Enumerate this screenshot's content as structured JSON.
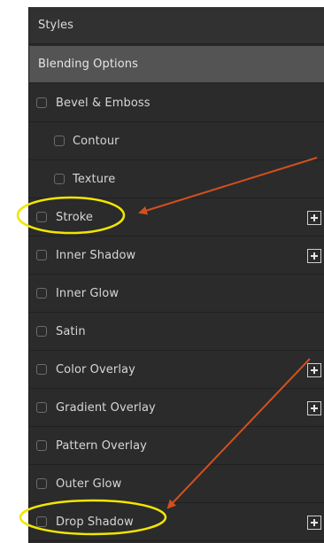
{
  "panel": {
    "header": "Styles",
    "blending": "Blending Options",
    "items": [
      {
        "label": "Bevel & Emboss",
        "indent": false,
        "plus": false
      },
      {
        "label": "Contour",
        "indent": true,
        "plus": false
      },
      {
        "label": "Texture",
        "indent": true,
        "plus": false
      },
      {
        "label": "Stroke",
        "indent": false,
        "plus": true
      },
      {
        "label": "Inner Shadow",
        "indent": false,
        "plus": true
      },
      {
        "label": "Inner Glow",
        "indent": false,
        "plus": false
      },
      {
        "label": "Satin",
        "indent": false,
        "plus": false
      },
      {
        "label": "Color Overlay",
        "indent": false,
        "plus": true
      },
      {
        "label": "Gradient Overlay",
        "indent": false,
        "plus": true
      },
      {
        "label": "Pattern Overlay",
        "indent": false,
        "plus": false
      },
      {
        "label": "Outer Glow",
        "indent": false,
        "plus": false
      },
      {
        "label": "Drop Shadow",
        "indent": false,
        "plus": true
      }
    ]
  },
  "annotations": {
    "ellipse_color": "#f2e600",
    "arrow_color": "#d2501e",
    "highlighted": [
      "Stroke",
      "Drop Shadow"
    ]
  },
  "icons": {
    "checkbox": "checkbox-icon",
    "add": "plus-box-icon"
  }
}
